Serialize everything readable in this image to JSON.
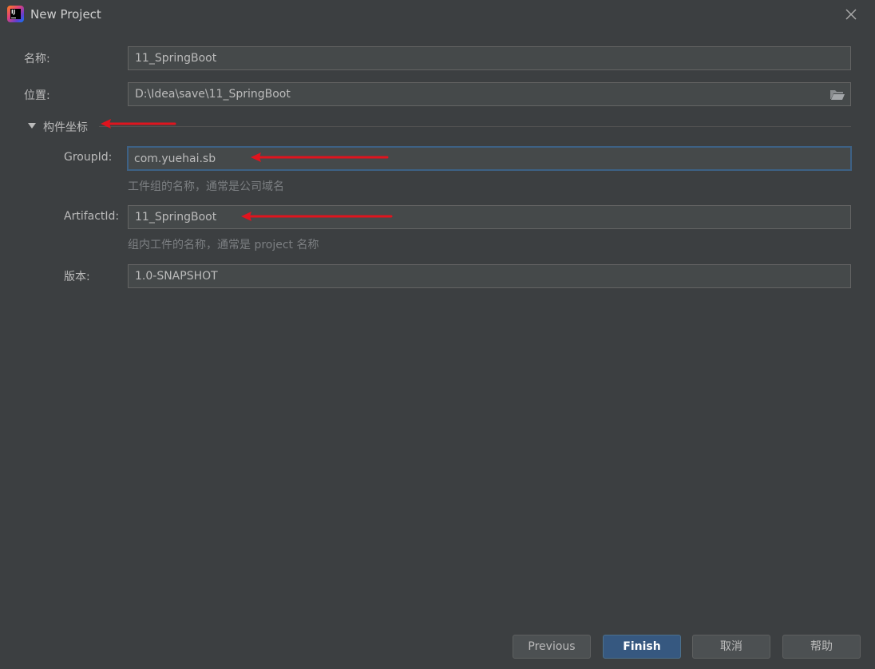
{
  "window": {
    "title": "New Project",
    "icon": "intellij-idea-icon"
  },
  "form": {
    "name": {
      "label": "名称:",
      "value": "11_SpringBoot"
    },
    "location": {
      "label": "位置:",
      "value": "D:\\Idea\\save\\11_SpringBoot"
    },
    "section": {
      "label": "构件坐标",
      "expanded": true
    },
    "group_id": {
      "label": "GroupId:",
      "value": "com.yuehai.sb",
      "hint": "工件组的名称，通常是公司域名"
    },
    "artifact_id": {
      "label": "ArtifactId:",
      "value": "11_SpringBoot",
      "hint": "组内工件的名称，通常是 project 名称"
    },
    "version": {
      "label": "版本:",
      "value": "1.0-SNAPSHOT"
    }
  },
  "buttons": {
    "previous": "Previous",
    "finish": "Finish",
    "cancel": "取消",
    "help": "帮助"
  },
  "colors": {
    "background": "#3c3f41",
    "field_background": "#45494a",
    "focus_border": "#3d6185",
    "primary_button": "#365880",
    "annotation_arrow": "#e0141e"
  }
}
